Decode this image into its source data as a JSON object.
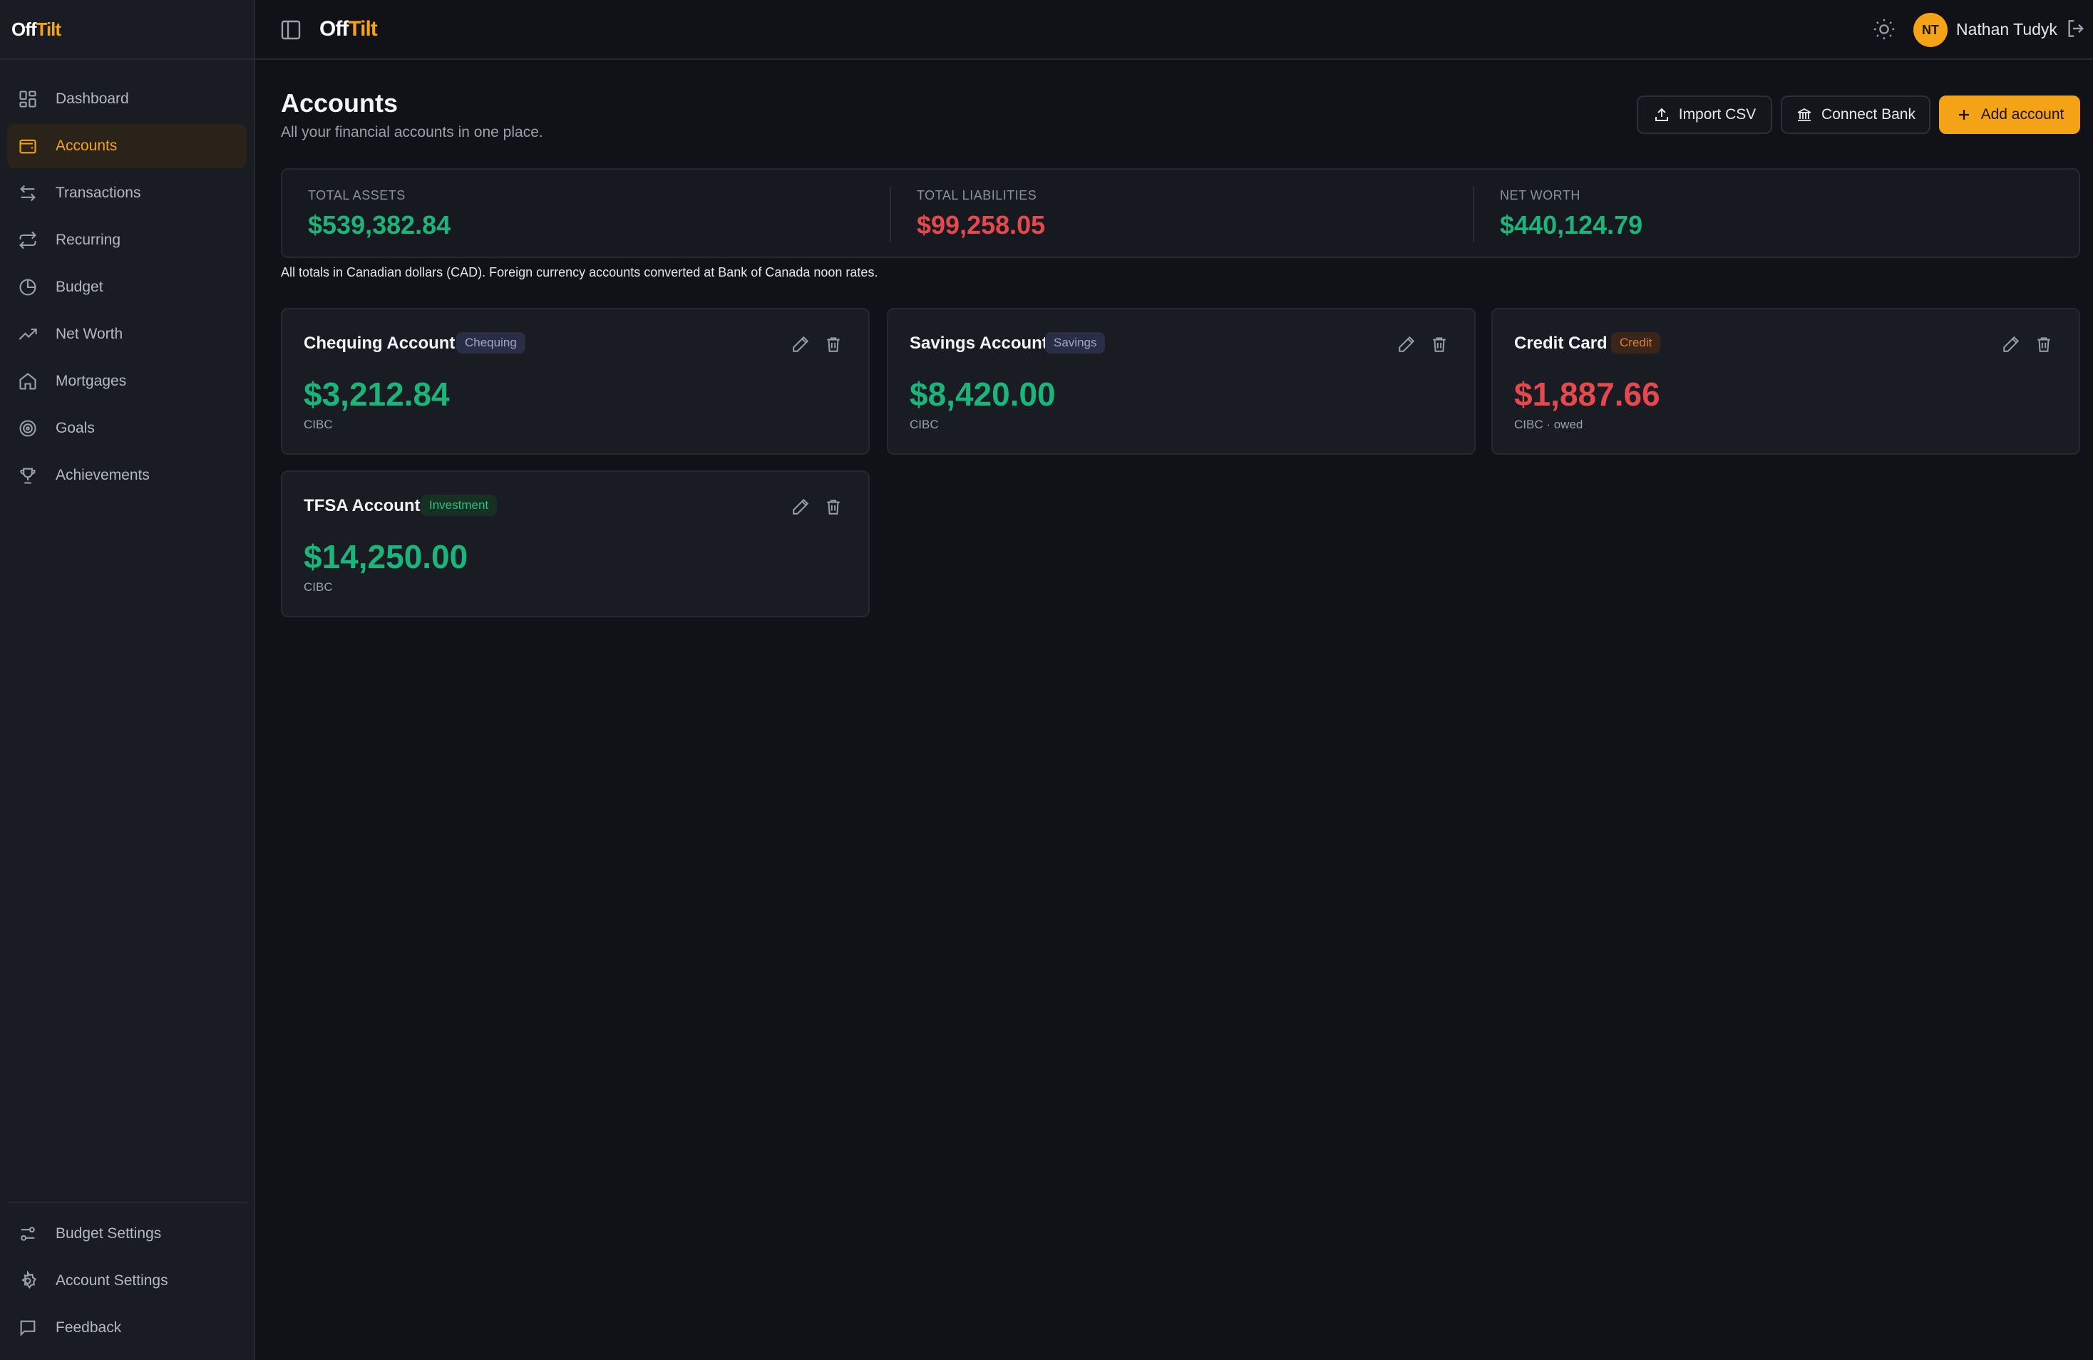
{
  "brand": {
    "part1": "Off",
    "part2": "Tilt"
  },
  "colors": {
    "accent": "#f5a316",
    "positive": "#1bb57a",
    "negative": "#e5484d",
    "background": "#111217",
    "sidebar": "#1a1c23"
  },
  "sidebar": {
    "items": [
      {
        "label": "Dashboard",
        "icon": "dashboard-icon"
      },
      {
        "label": "Accounts",
        "icon": "wallet-icon",
        "active": true
      },
      {
        "label": "Transactions",
        "icon": "arrows-left-right-icon"
      },
      {
        "label": "Recurring",
        "icon": "repeat-icon"
      },
      {
        "label": "Budget",
        "icon": "pie-chart-icon"
      },
      {
        "label": "Net Worth",
        "icon": "trending-up-icon"
      },
      {
        "label": "Mortgages",
        "icon": "home-icon"
      },
      {
        "label": "Goals",
        "icon": "target-icon"
      },
      {
        "label": "Achievements",
        "icon": "trophy-icon"
      }
    ],
    "bottom_items": [
      {
        "label": "Budget Settings",
        "icon": "sliders-icon"
      },
      {
        "label": "Account Settings",
        "icon": "gear-icon"
      },
      {
        "label": "Feedback",
        "icon": "message-icon"
      }
    ]
  },
  "header": {
    "user_initials": "NT",
    "user_name": "Nathan Tudyk"
  },
  "page": {
    "title": "Accounts",
    "subtitle": "All your financial accounts in one place.",
    "buttons": {
      "import_csv": "Import CSV",
      "connect_bank": "Connect Bank",
      "add_account": "Add account"
    },
    "summary": {
      "total_assets_label": "TOTAL ASSETS",
      "total_assets": "$539,382.84",
      "total_liabilities_label": "TOTAL LIABILITIES",
      "total_liabilities": "$99,258.05",
      "net_worth_label": "NET WORTH",
      "net_worth": "$440,124.79"
    },
    "note": "All totals in Canadian dollars (CAD). Foreign currency accounts converted at Bank of Canada noon rates."
  },
  "accounts": [
    {
      "name": "Chequing Account",
      "type": "Chequing",
      "amount": "$3,212.84",
      "institution": "CIBC"
    },
    {
      "name": "Savings Account",
      "type": "Savings",
      "amount": "$8,420.00",
      "institution": "CIBC"
    },
    {
      "name": "Credit Card",
      "type": "Credit",
      "amount": "$1,887.66",
      "institution": "CIBC · owed"
    },
    {
      "name": "TFSA Account",
      "type": "Investment",
      "amount": "$14,250.00",
      "institution": "CIBC"
    }
  ]
}
